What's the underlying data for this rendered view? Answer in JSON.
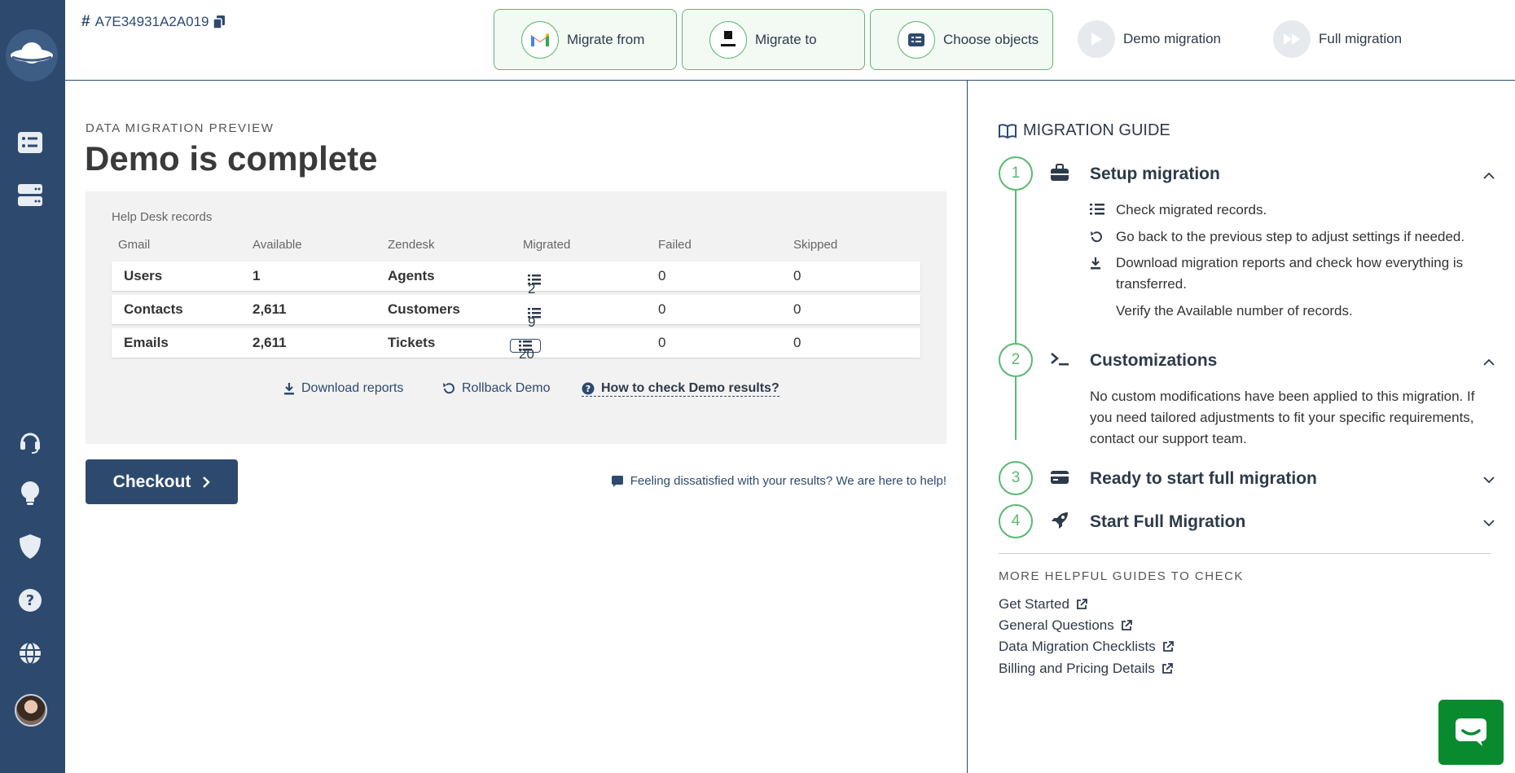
{
  "header": {
    "migration_id": "A7E34931A2A019",
    "steps": [
      {
        "label": "Migrate from"
      },
      {
        "label": "Migrate to"
      },
      {
        "label": "Choose objects"
      },
      {
        "label": "Demo migration"
      },
      {
        "label": "Full migration"
      }
    ]
  },
  "main": {
    "eyebrow": "DATA MIGRATION PREVIEW",
    "title": "Demo is complete",
    "panel_caption": "Help Desk records",
    "columns": [
      "Gmail",
      "Available",
      "Zendesk",
      "Migrated",
      "Failed",
      "Skipped"
    ],
    "rows": [
      {
        "source": "Users",
        "available": "1",
        "target": "Agents",
        "migrated": "2",
        "failed": "0",
        "skipped": "0"
      },
      {
        "source": "Contacts",
        "available": "2,611",
        "target": "Customers",
        "migrated": "9",
        "failed": "0",
        "skipped": "0"
      },
      {
        "source": "Emails",
        "available": "2,611",
        "target": "Tickets",
        "migrated": "20",
        "failed": "0",
        "skipped": "0"
      }
    ],
    "download_reports": "Download reports",
    "rollback_demo": "Rollback Demo",
    "how_to_check": "How to check Demo results?",
    "checkout": "Checkout",
    "help_note": "Feeling dissatisfied with your results? We are here to help!"
  },
  "guide": {
    "title": "MIGRATION GUIDE",
    "sections": [
      {
        "num": "1",
        "title": "Setup migration",
        "expanded": true
      },
      {
        "num": "2",
        "title": "Customizations",
        "expanded": true
      },
      {
        "num": "3",
        "title": "Ready to start full migration",
        "expanded": false
      },
      {
        "num": "4",
        "title": "Start Full Migration",
        "expanded": false
      }
    ],
    "setup_items": [
      "Check migrated records.",
      "Go back to the previous step to adjust settings if needed.",
      "Download migration reports and check how everything is transferred.",
      "Verify the Available number of records."
    ],
    "customizations_text": "No custom modifications have been applied to this migration. If you need tailored adjustments to fit your specific requirements, contact our support team.",
    "more_title": "MORE HELPFUL GUIDES TO CHECK",
    "links": [
      "Get Started",
      "General Questions",
      "Data Migration Checklists",
      "Billing and Pricing Details"
    ]
  },
  "colors": {
    "navy": "#2d4a6e",
    "green": "#5cb870",
    "chat_green": "#0a8a2f"
  }
}
